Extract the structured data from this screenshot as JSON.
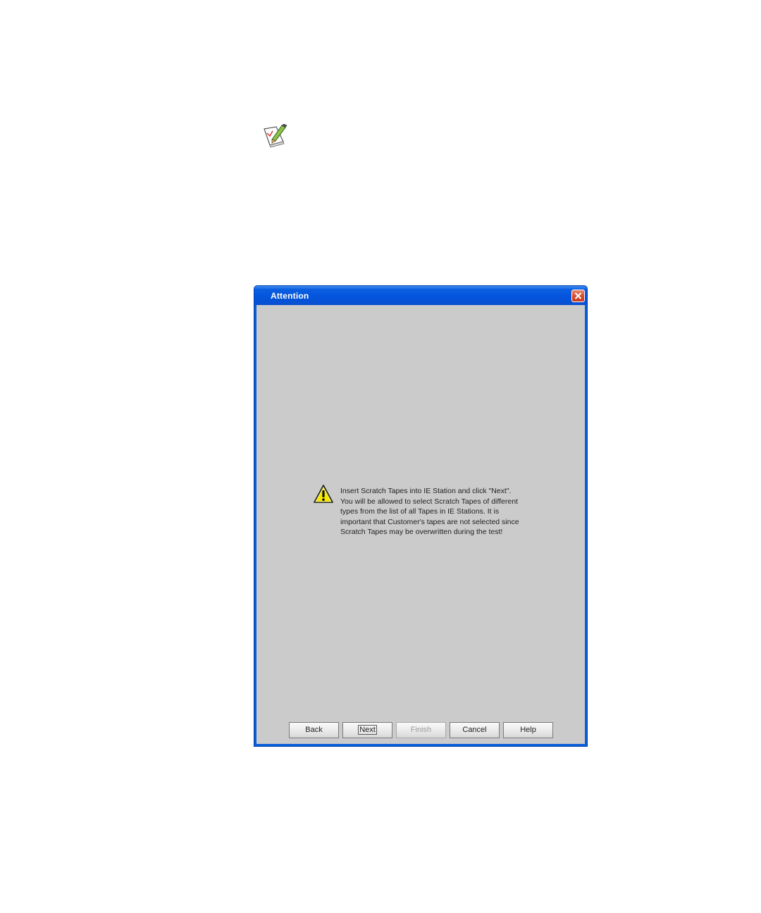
{
  "page": {
    "note_icon": "note-pencil-icon"
  },
  "dialog": {
    "title": "Attention",
    "close_icon": "close-icon",
    "warning_icon": "warning-icon",
    "message": "Insert Scratch Tapes into IE Station and click \"Next\".\nYou will be allowed to select Scratch Tapes of different\ntypes from the list of all Tapes in IE Stations. It is\nimportant that Customer's tapes are not selected since\nScratch Tapes may be overwritten during the test!",
    "buttons": {
      "back": "Back",
      "next": "Next",
      "finish": "Finish",
      "cancel": "Cancel",
      "help": "Help"
    },
    "finish_disabled": true,
    "focused_button": "Next"
  },
  "colors": {
    "title_bar": "#0454dc",
    "close_button": "#d84a2b",
    "client_background": "#cbcbcb",
    "warning_yellow": "#f5e800"
  }
}
